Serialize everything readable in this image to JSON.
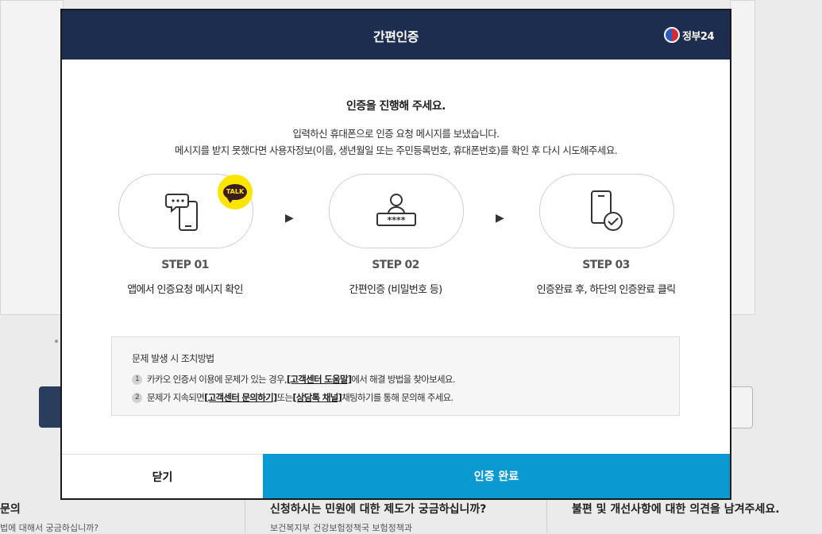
{
  "background": {
    "col1_title": "문의",
    "col1_sub": "법에 대해서 궁금하십니까?",
    "col2_title": "신청하시는 민원에 대한 제도가 궁금하십니까?",
    "col2_sub": "보건복지부 건강보험정책국 보험정책과",
    "col3_title": "불편 및 개선사항에 대한 의견을 남겨주세요."
  },
  "modal": {
    "title": "간편인증",
    "logo_text": "정부24",
    "heading": "인증을 진행해 주세요.",
    "desc_line1": "입력하신 휴대폰으로 인증 요청 메시지를 보냈습니다.",
    "desc_line2": "메시지를 받지 못했다면 사용자정보(이름, 생년월일 또는 주민등록번호, 휴대폰번호)를 확인 후 다시 시도해주세요.",
    "talk_badge": "TALK",
    "steps": [
      {
        "label": "STEP 01",
        "desc": "앱에서 인증요청 메시지 확인",
        "icon": "phone-chat-icon"
      },
      {
        "label": "STEP 02",
        "desc": "간편인증 (비밀번호 등)",
        "icon": "user-password-icon"
      },
      {
        "label": "STEP 03",
        "desc": "인증완료 후, 하단의 인증완료 클릭",
        "icon": "phone-check-icon"
      }
    ],
    "help": {
      "title": "문제 발생 시 조치방법",
      "items": [
        {
          "num": "1",
          "pre": "카카오 인증서 이용에 문제가 있는 경우, ",
          "link1": "[고객센터 도움말]",
          "mid": " 에서 해결 방법을 찾아보세요.",
          "link2": "",
          "post": ""
        },
        {
          "num": "2",
          "pre": "문제가 지속되면 ",
          "link1": "[고객센터 문의하기]",
          "mid": " 또는 ",
          "link2": "[상담톡 채널]",
          "post": " 채팅하기를 통해 문의해 주세요."
        }
      ]
    },
    "close_label": "닫기",
    "confirm_label": "인증 완료"
  },
  "colors": {
    "header_bg": "#1c2d4f",
    "confirm_bg": "#0a99d1",
    "kakao_yellow": "#fce500"
  }
}
